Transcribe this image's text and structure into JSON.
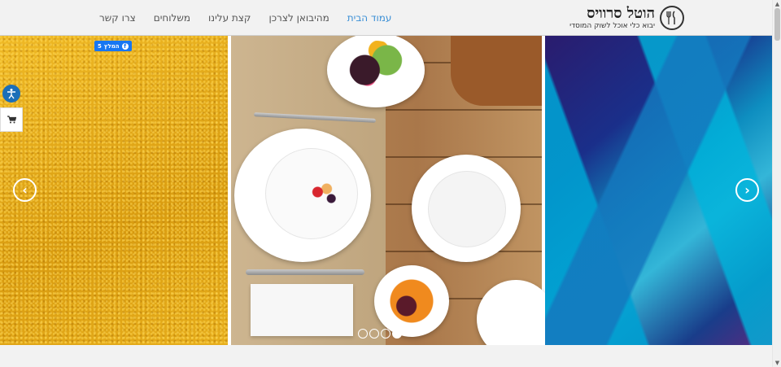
{
  "header": {
    "logo": {
      "title": "הוטל סרוויס",
      "subtitle": "יבוא כלי אוכל לשוק המוסדי"
    },
    "nav": [
      {
        "label": "עמוד הבית",
        "active": true
      },
      {
        "label": "מהיבואן לצרכן",
        "active": false
      },
      {
        "label": "קצת עלינו",
        "active": false
      },
      {
        "label": "משלוחים",
        "active": false
      },
      {
        "label": "צרו קשר",
        "active": false
      }
    ]
  },
  "facebook": {
    "label": "המלץ",
    "count": "5"
  },
  "slider": {
    "prev_icon": "chevron-left-icon",
    "next_icon": "chevron-right-icon",
    "dots": 4,
    "active_dot": 3
  },
  "icons": {
    "accessibility": "accessibility-icon",
    "cart": "cart-icon",
    "logo": "fork-knife-icon"
  },
  "colors": {
    "accent": "#3a8fd6",
    "facebook": "#1877f2",
    "accessibility": "#1b6fb8"
  }
}
